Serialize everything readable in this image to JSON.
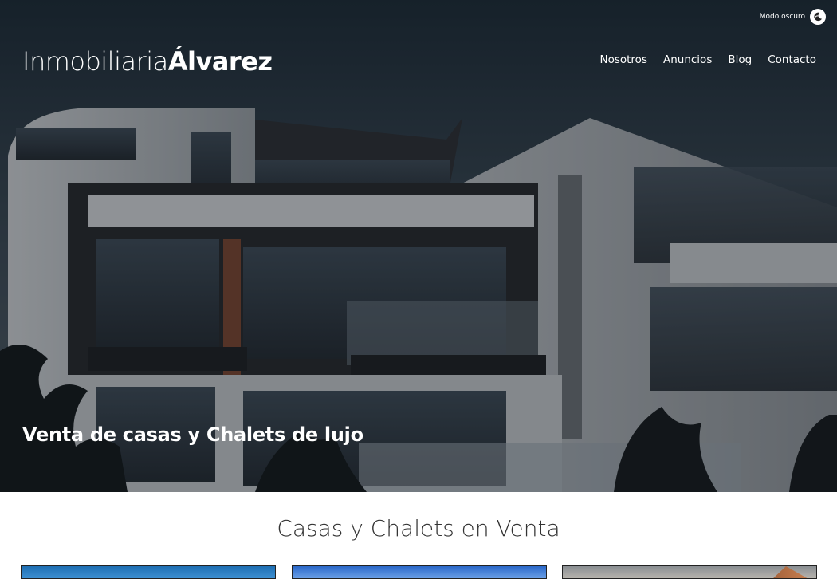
{
  "header": {
    "logo_light": "Inmobiliaria",
    "logo_bold": "Álvarez",
    "dark_mode_label": "Modo oscuro",
    "dark_mode_icon": "moon-icon",
    "nav": [
      {
        "label": "Nosotros"
      },
      {
        "label": "Anuncios"
      },
      {
        "label": "Blog"
      },
      {
        "label": "Contacto"
      }
    ]
  },
  "hero": {
    "title": "Venta de casas y Chalets de lujo"
  },
  "listings": {
    "title": "Casas y Chalets en Venta"
  },
  "colors": {
    "hero_overlay": "#0f1216",
    "text_light": "#ffffff",
    "text_dark": "#333333"
  }
}
